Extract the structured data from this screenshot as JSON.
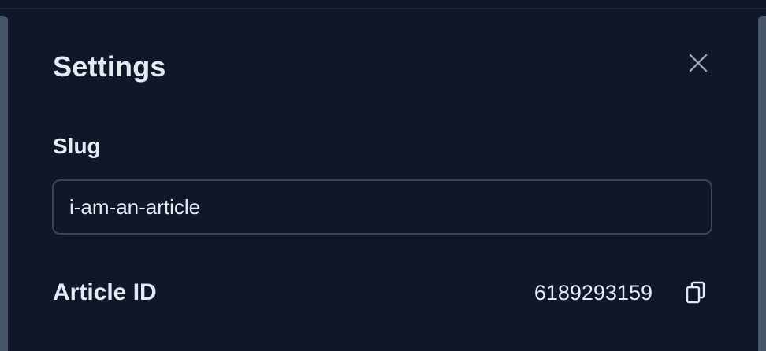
{
  "panel": {
    "title": "Settings",
    "close_icon": "close-icon"
  },
  "slug": {
    "label": "Slug",
    "value": "i-am-an-article"
  },
  "article": {
    "label": "Article ID",
    "id": "6189293159",
    "copy_icon": "copy-icon"
  },
  "colors": {
    "background": "#0f1729",
    "text": "#e6ebf3",
    "border": "#3a4658",
    "rail": "#475569",
    "icon": "#94a3b8"
  }
}
